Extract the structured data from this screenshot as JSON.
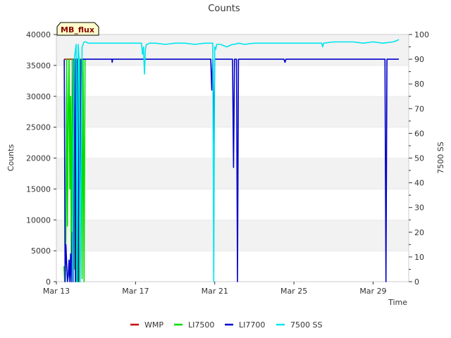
{
  "chart_data": {
    "type": "line",
    "title": "Counts",
    "xlabel": "Time",
    "ylabel": "Counts",
    "y2label": "7500 SS",
    "badge": "MB_flux",
    "xlim": [
      0,
      17.8
    ],
    "ylim": [
      0,
      40000
    ],
    "y2lim": [
      0,
      100
    ],
    "x_ticks": [
      {
        "value": 0,
        "label": "Mar 13"
      },
      {
        "value": 4,
        "label": "Mar 17"
      },
      {
        "value": 8,
        "label": "Mar 21"
      },
      {
        "value": 12,
        "label": "Mar 25"
      },
      {
        "value": 16,
        "label": "Mar 29"
      }
    ],
    "y_ticks": [
      0,
      5000,
      10000,
      15000,
      20000,
      25000,
      30000,
      35000,
      40000
    ],
    "y2_ticks": [
      0,
      10,
      20,
      30,
      40,
      50,
      60,
      70,
      80,
      90,
      100
    ],
    "grid": "horizontal-bands",
    "legend_position": "bottom",
    "series": [
      {
        "name": "WMP",
        "color": "#cc0000",
        "axis": "left",
        "x": [
          0.4,
          0.55,
          0.7,
          0.85,
          1.0,
          1.15
        ],
        "y": [
          36000,
          36000,
          36000,
          36000,
          36000,
          36000
        ]
      },
      {
        "name": "LI7500",
        "color": "#00dd00",
        "axis": "left",
        "x": [
          0.38,
          0.42,
          0.48,
          0.52,
          0.56,
          0.6,
          0.64,
          0.68,
          0.72,
          0.76,
          0.8,
          0.84,
          0.88,
          0.92,
          0.96,
          1.0,
          1.05,
          1.1,
          1.15,
          1.2,
          1.25,
          1.3,
          1.35,
          1.4,
          1.45,
          1.5
        ],
        "y": [
          2500,
          0,
          7000,
          36000,
          9000,
          28000,
          36000,
          15000,
          30000,
          500,
          36000,
          8000,
          36000,
          2000,
          36000,
          0,
          1000,
          36000,
          0,
          36000,
          36000,
          500,
          36000,
          0,
          36000,
          36000
        ]
      },
      {
        "name": "LI7700",
        "color": "#0000cc",
        "axis": "left",
        "x": [
          0.4,
          0.44,
          0.48,
          0.52,
          0.56,
          0.6,
          0.64,
          0.68,
          0.72,
          0.76,
          0.8,
          0.84,
          0.88,
          0.92,
          0.96,
          1.0,
          1.05,
          1.1,
          1.15,
          1.2,
          1.25,
          1.3,
          1.35,
          1.4,
          1.45,
          1.5,
          2.8,
          2.82,
          2.84,
          3.0,
          4.0,
          5.0,
          6.0,
          7.0,
          7.8,
          7.85,
          7.9,
          7.95,
          8.0,
          8.05,
          8.2,
          8.5,
          8.8,
          8.9,
          8.95,
          9.0,
          9.05,
          9.1,
          9.15,
          9.2,
          9.25,
          9.3,
          9.4,
          10.0,
          11.0,
          11.5,
          11.55,
          11.6,
          12.0,
          13.0,
          14.0,
          15.0,
          16.0,
          16.6,
          16.65,
          16.7,
          16.75,
          17.0,
          17.3
        ],
        "y": [
          36000,
          0,
          6000,
          3000,
          0,
          1000,
          3500,
          0,
          4500,
          0,
          8000,
          0,
          36000,
          36000,
          0,
          36000,
          36000,
          0,
          36000,
          0,
          36000,
          36000,
          36000,
          36000,
          36000,
          36000,
          36000,
          35500,
          36000,
          36000,
          36000,
          36000,
          36000,
          36000,
          36000,
          31000,
          36000,
          22000,
          36000,
          36000,
          36000,
          36000,
          36000,
          36000,
          18500,
          36000,
          36000,
          36000,
          0,
          36000,
          36000,
          36000,
          36000,
          36000,
          36000,
          36000,
          35500,
          36000,
          36000,
          36000,
          36000,
          36000,
          36000,
          36000,
          0,
          36000,
          36000,
          36000,
          36000
        ]
      },
      {
        "name": "7500 SS",
        "color": "#00e5ee",
        "axis": "right",
        "x": [
          0.8,
          0.9,
          1.0,
          1.05,
          1.1,
          1.15,
          1.2,
          1.3,
          1.4,
          1.5,
          1.6,
          2.0,
          2.5,
          3.0,
          3.5,
          4.0,
          4.3,
          4.35,
          4.4,
          4.45,
          4.5,
          4.55,
          4.6,
          4.7,
          5.0,
          5.5,
          6.0,
          6.5,
          7.0,
          7.5,
          7.9,
          7.95,
          8.0,
          8.05,
          8.1,
          8.15,
          8.3,
          8.6,
          8.9,
          9.0,
          9.2,
          9.5,
          10.0,
          10.5,
          11.0,
          11.5,
          12.0,
          12.5,
          13.0,
          13.4,
          13.45,
          13.5,
          14.0,
          14.5,
          15.0,
          15.5,
          16.0,
          16.5,
          17.0,
          17.2,
          17.3
        ],
        "y": [
          0,
          90,
          96,
          0,
          96,
          90,
          0,
          95,
          97,
          97,
          96.5,
          96.5,
          96.5,
          96.5,
          96.5,
          96.5,
          96.5,
          92,
          95,
          84,
          94,
          96,
          96,
          96.5,
          96.5,
          96,
          96.5,
          96.5,
          96,
          96.5,
          96.5,
          0,
          95,
          94,
          96,
          96,
          96,
          95,
          96,
          96,
          96.5,
          96,
          96.5,
          96.5,
          96.5,
          96.5,
          96.5,
          96.5,
          96.5,
          96.5,
          95,
          96.5,
          97,
          97,
          97,
          96.5,
          97,
          96.5,
          97,
          97.5,
          98
        ]
      }
    ]
  }
}
